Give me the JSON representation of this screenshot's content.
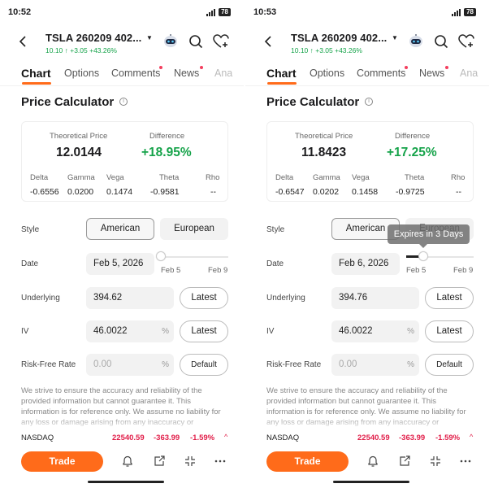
{
  "panels": [
    {
      "status": {
        "time": "10:52",
        "battery": "78"
      },
      "header": {
        "title": "TSLA 260209 402...",
        "change": "10.10 ↑ +3.05 +43.26%"
      },
      "tabs": [
        "Chart",
        "Options",
        "Comments",
        "News",
        "Ana"
      ],
      "section_title": "Price Calculator",
      "result": {
        "theo_label": "Theoretical Price",
        "theo_value": "12.0144",
        "diff_label": "Difference",
        "diff_value": "+18.95%",
        "greeks": [
          {
            "label": "Delta",
            "value": "-0.6556"
          },
          {
            "label": "Gamma",
            "value": "0.0200"
          },
          {
            "label": "Vega",
            "value": "0.1474"
          },
          {
            "label": "Theta",
            "value": "-0.9581"
          },
          {
            "label": "Rho",
            "value": "--"
          }
        ]
      },
      "form": {
        "style_label": "Style",
        "style_american": "American",
        "style_european": "European",
        "date_label": "Date",
        "date_value": "Feb 5, 2026",
        "slider_start": "Feb 5",
        "slider_end": "Feb 9",
        "slider_level": 0.0,
        "underlying_label": "Underlying",
        "underlying_value": "394.62",
        "latest": "Latest",
        "iv_label": "IV",
        "iv_value": "46.0022",
        "pct": "%",
        "rf_label": "Risk-Free Rate",
        "rf_value": "0.00",
        "default": "Default"
      },
      "disclaimer": "We strive to ensure the accuracy and reliability of the provided information but cannot guarantee it. This information is for reference only. We assume no liability for any loss or damage arising from any inaccuracy or",
      "index": {
        "name": "NASDAQ",
        "price": "22540.59",
        "change": "-363.99",
        "pct": "-1.59%"
      },
      "trade": "Trade"
    },
    {
      "status": {
        "time": "10:53",
        "battery": "78"
      },
      "header": {
        "title": "TSLA 260209 402...",
        "change": "10.10 ↑ +3.05 +43.26%"
      },
      "tabs": [
        "Chart",
        "Options",
        "Comments",
        "News",
        "Ana"
      ],
      "section_title": "Price Calculator",
      "result": {
        "theo_label": "Theoretical Price",
        "theo_value": "11.8423",
        "diff_label": "Difference",
        "diff_value": "+17.25%",
        "greeks": [
          {
            "label": "Delta",
            "value": "-0.6547"
          },
          {
            "label": "Gamma",
            "value": "0.0202"
          },
          {
            "label": "Vega",
            "value": "0.1458"
          },
          {
            "label": "Theta",
            "value": "-0.9725"
          },
          {
            "label": "Rho",
            "value": "--"
          }
        ]
      },
      "form": {
        "style_label": "Style",
        "style_american": "American",
        "style_european": "European",
        "date_label": "Date",
        "date_value": "Feb 6, 2026",
        "slider_start": "Feb 5",
        "slider_end": "Feb 9",
        "slider_level": 0.25,
        "tooltip": "Expires in 3 Days",
        "underlying_label": "Underlying",
        "underlying_value": "394.76",
        "latest": "Latest",
        "iv_label": "IV",
        "iv_value": "46.0022",
        "pct": "%",
        "rf_label": "Risk-Free Rate",
        "rf_value": "0.00",
        "default": "Default"
      },
      "disclaimer": "We strive to ensure the accuracy and reliability of the provided information but cannot guarantee it. This information is for reference only. We assume no liability for any loss or damage arising from any inaccuracy or",
      "index": {
        "name": "NASDAQ",
        "price": "22540.59",
        "change": "-363.99",
        "pct": "-1.59%"
      },
      "trade": "Trade"
    }
  ],
  "colors": {
    "accent": "#ff6b1a",
    "positive": "#16a34a",
    "negative": "#e11d48"
  }
}
